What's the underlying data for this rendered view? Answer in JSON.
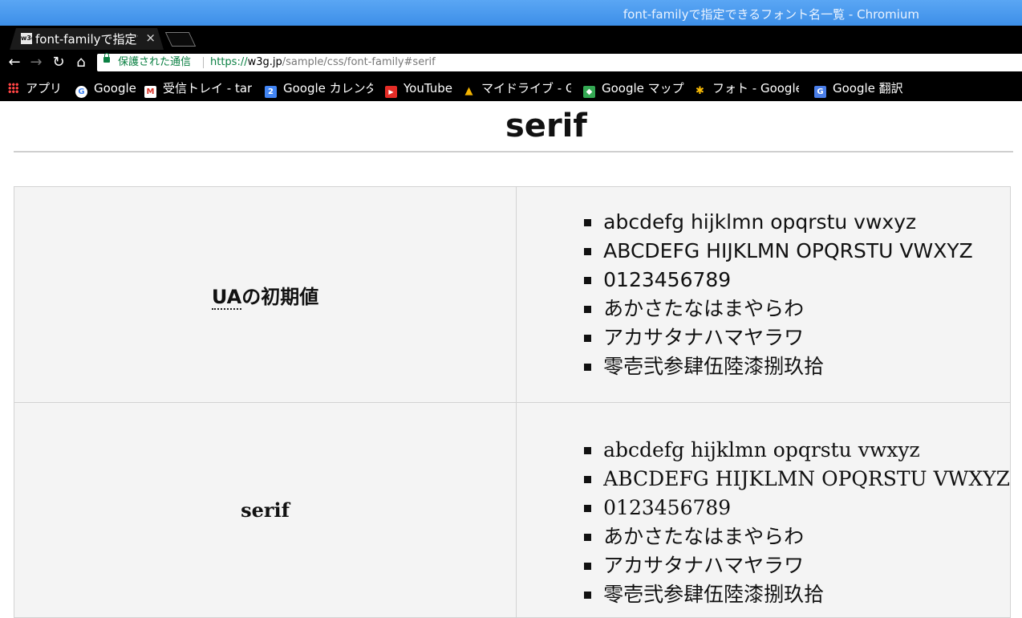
{
  "window": {
    "title": "font-familyで指定できるフォント名一覧 - Chromium"
  },
  "tab": {
    "favicon": "w3g",
    "title": "font-familyで指定できるフォント名一覧",
    "close": "×"
  },
  "toolbar": {
    "back": "←",
    "forward": "→",
    "reload": "↻",
    "home": "⌂",
    "secure_label": "保護された通信",
    "url_scheme": "https://",
    "url_host": "w3g.jp",
    "url_path": "/sample/css/font-family#serif"
  },
  "bookmarks": [
    {
      "label": "アプリ",
      "icon": "apps-grid-icon"
    },
    {
      "label": "Google",
      "icon": "google-icon"
    },
    {
      "label": "受信トレイ - tar",
      "icon": "gmail-icon"
    },
    {
      "label": "Google カレンダ",
      "icon": "calendar-icon"
    },
    {
      "label": "YouTube",
      "icon": "youtube-icon"
    },
    {
      "label": "マイドライブ - G",
      "icon": "drive-icon"
    },
    {
      "label": "Google マップ",
      "icon": "maps-icon"
    },
    {
      "label": "フォト - Google",
      "icon": "photos-icon"
    },
    {
      "label": "Google 翻訳",
      "icon": "translate-icon"
    }
  ],
  "page": {
    "heading": "serif",
    "rows": [
      {
        "label_abbr": "UA",
        "label_rest": "の初期値",
        "samples": [
          "abcdefg hijklmn opqrstu vwxyz",
          "ABCDEFG HIJKLMN OPQRSTU VWXYZ",
          "0123456789",
          "あかさたなはまやらわ",
          "アカサタナハマヤラワ",
          "零壱弐参肆伍陸漆捌玖拾"
        ]
      },
      {
        "label": "serif",
        "samples": [
          "abcdefg hijklmn opqrstu vwxyz",
          "ABCDEFG HIJKLMN OPQRSTU VWXYZ",
          "0123456789",
          "あかさたなはまやらわ",
          "アカサタナハマヤラワ",
          "零壱弐参肆伍陸漆捌玖拾"
        ]
      }
    ]
  }
}
